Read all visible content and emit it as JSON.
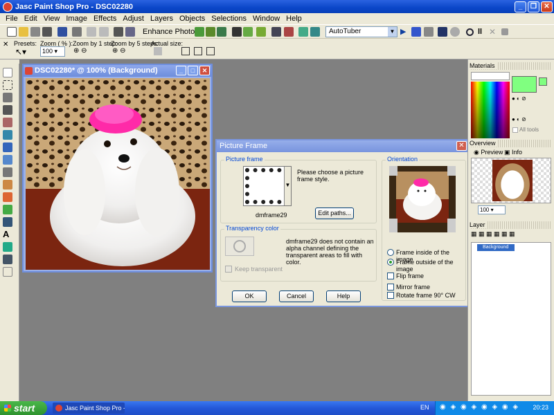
{
  "window": {
    "title": "Jasc Paint Shop Pro - DSC02280"
  },
  "menu": [
    "File",
    "Edit",
    "View",
    "Image",
    "Effects",
    "Adjust",
    "Layers",
    "Objects",
    "Selections",
    "Window",
    "Help"
  ],
  "toolbar": {
    "enhance_label": "Enhance Photo",
    "script_select": "AutoTuber"
  },
  "tool_options": {
    "presets_label": "Presets:",
    "zoom_label": "Zoom ( % ):",
    "zoom_value": "100",
    "zoom1_label": "Zoom by 1 step:",
    "zoom5_label": "Zoom by 5 steps:",
    "actual_label": "Actual size:"
  },
  "image_window": {
    "title": "DSC02280* @ 100% (Background)"
  },
  "dialog": {
    "title": "Picture Frame",
    "picture_frame_label": "Picture frame",
    "choose_text": "Please choose a picture frame style.",
    "frame_name": "dmframe29",
    "edit_paths": "Edit paths...",
    "orientation_label": "Orientation",
    "frame_inside": "Frame inside of the image",
    "frame_outside": "Frame outside of the image",
    "selected_orientation": "Frame outside of the image",
    "flip_frame": "Flip frame",
    "mirror_frame": "Mirror frame",
    "rotate_frame": "Rotate frame 90° CW",
    "transparency_label": "Transparency color",
    "alpha_text": "dmframe29 does not contain an alpha channel defining the transparent areas to fill with color.",
    "keep_transparent": "Keep transparent",
    "ok": "OK",
    "cancel": "Cancel",
    "help": "Help"
  },
  "panels": {
    "materials": {
      "title": "Materials",
      "all_tools": "All tools",
      "foreground_color": "#80ff80"
    },
    "overview": {
      "title": "Overview",
      "tab_preview": "Preview",
      "tab_info": "Info",
      "zoom": "100"
    },
    "layers": {
      "title": "Layer",
      "layer_name": "Background"
    }
  },
  "taskbar": {
    "start": "start",
    "task_item": "Jasc Paint Shop Pro - ...",
    "lang": "EN",
    "clock": "20:23"
  }
}
